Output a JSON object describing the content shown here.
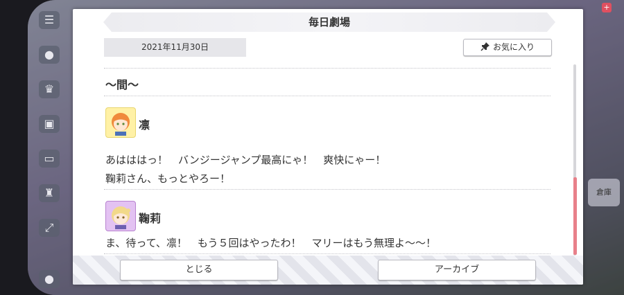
{
  "dialog": {
    "title": "毎日劇場",
    "date": "2021年11月30日",
    "favorite_label": "お気に入り",
    "episode_title": "〜間〜",
    "entries": [
      {
        "speaker": "凛",
        "lines": [
          "あはははっ！　バンジージャンプ最高にゃ！　爽快にゃー！",
          "鞠莉さん、もっとやろー！"
        ]
      },
      {
        "speaker": "鞠莉",
        "lines": [
          "ま、待って、凛！　もう５回はやったわ！　マリーはもう無理よ〜〜！"
        ]
      }
    ],
    "close_label": "とじる",
    "archive_label": "アーカイブ"
  },
  "background": {
    "right_tile_label": "倉庫",
    "badge": "+"
  },
  "colors": {
    "scroll_thumb": "#e8808a",
    "rin_avatar": "#fff1a6",
    "mari_avatar": "#e3c2f2"
  }
}
